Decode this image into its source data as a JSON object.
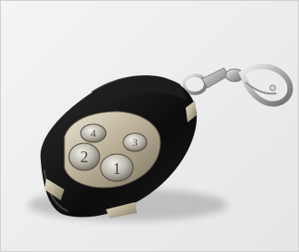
{
  "image": {
    "subject": "remote-key-fob",
    "colors": {
      "background": "#ededed",
      "body": "#111111",
      "metal": "#c9c2ae",
      "button": "#bfbcb4",
      "chain": "#b8b8b8"
    },
    "buttons": [
      {
        "name": "button-1",
        "label": "1"
      },
      {
        "name": "button-2",
        "label": "2"
      },
      {
        "name": "button-3",
        "label": "3"
      },
      {
        "name": "button-4",
        "label": "4"
      }
    ]
  }
}
